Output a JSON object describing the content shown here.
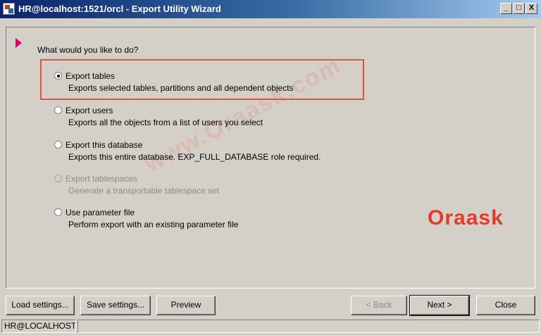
{
  "window": {
    "title": "HR@localhost:1521/orcl - Export Utility Wizard",
    "minimize": "_",
    "maximize": "□",
    "close": "X"
  },
  "wizard": {
    "question": "What would you like to do?",
    "options": [
      {
        "label": "Export tables",
        "desc": "Exports selected tables, partitions and all dependent objects",
        "selected": true,
        "enabled": true
      },
      {
        "label": "Export users",
        "desc": "Exports all the objects from a list of users you select",
        "selected": false,
        "enabled": true
      },
      {
        "label": "Export this database",
        "desc": "Exports this entire database.  EXP_FULL_DATABASE role required.",
        "selected": false,
        "enabled": true
      },
      {
        "label": "Export tablespaces",
        "desc": "Generate a transportable tablespace set",
        "selected": false,
        "enabled": false
      },
      {
        "label": "Use parameter file",
        "desc": "Perform export with an existing parameter file",
        "selected": false,
        "enabled": true
      }
    ]
  },
  "watermark": "www.Oraask.com",
  "logo": "Oraask",
  "buttons": {
    "load": "Load settings...",
    "save": "Save settings...",
    "preview": "Preview",
    "back": "< Back",
    "next": "Next >",
    "close": "Close"
  },
  "status": {
    "connection": "HR@LOCALHOST",
    "message": ""
  },
  "colors": {
    "titlebar_start": "#0a246a",
    "highlight": "#e0533f",
    "marker": "#d6006e",
    "logo": "#e23b2e"
  }
}
